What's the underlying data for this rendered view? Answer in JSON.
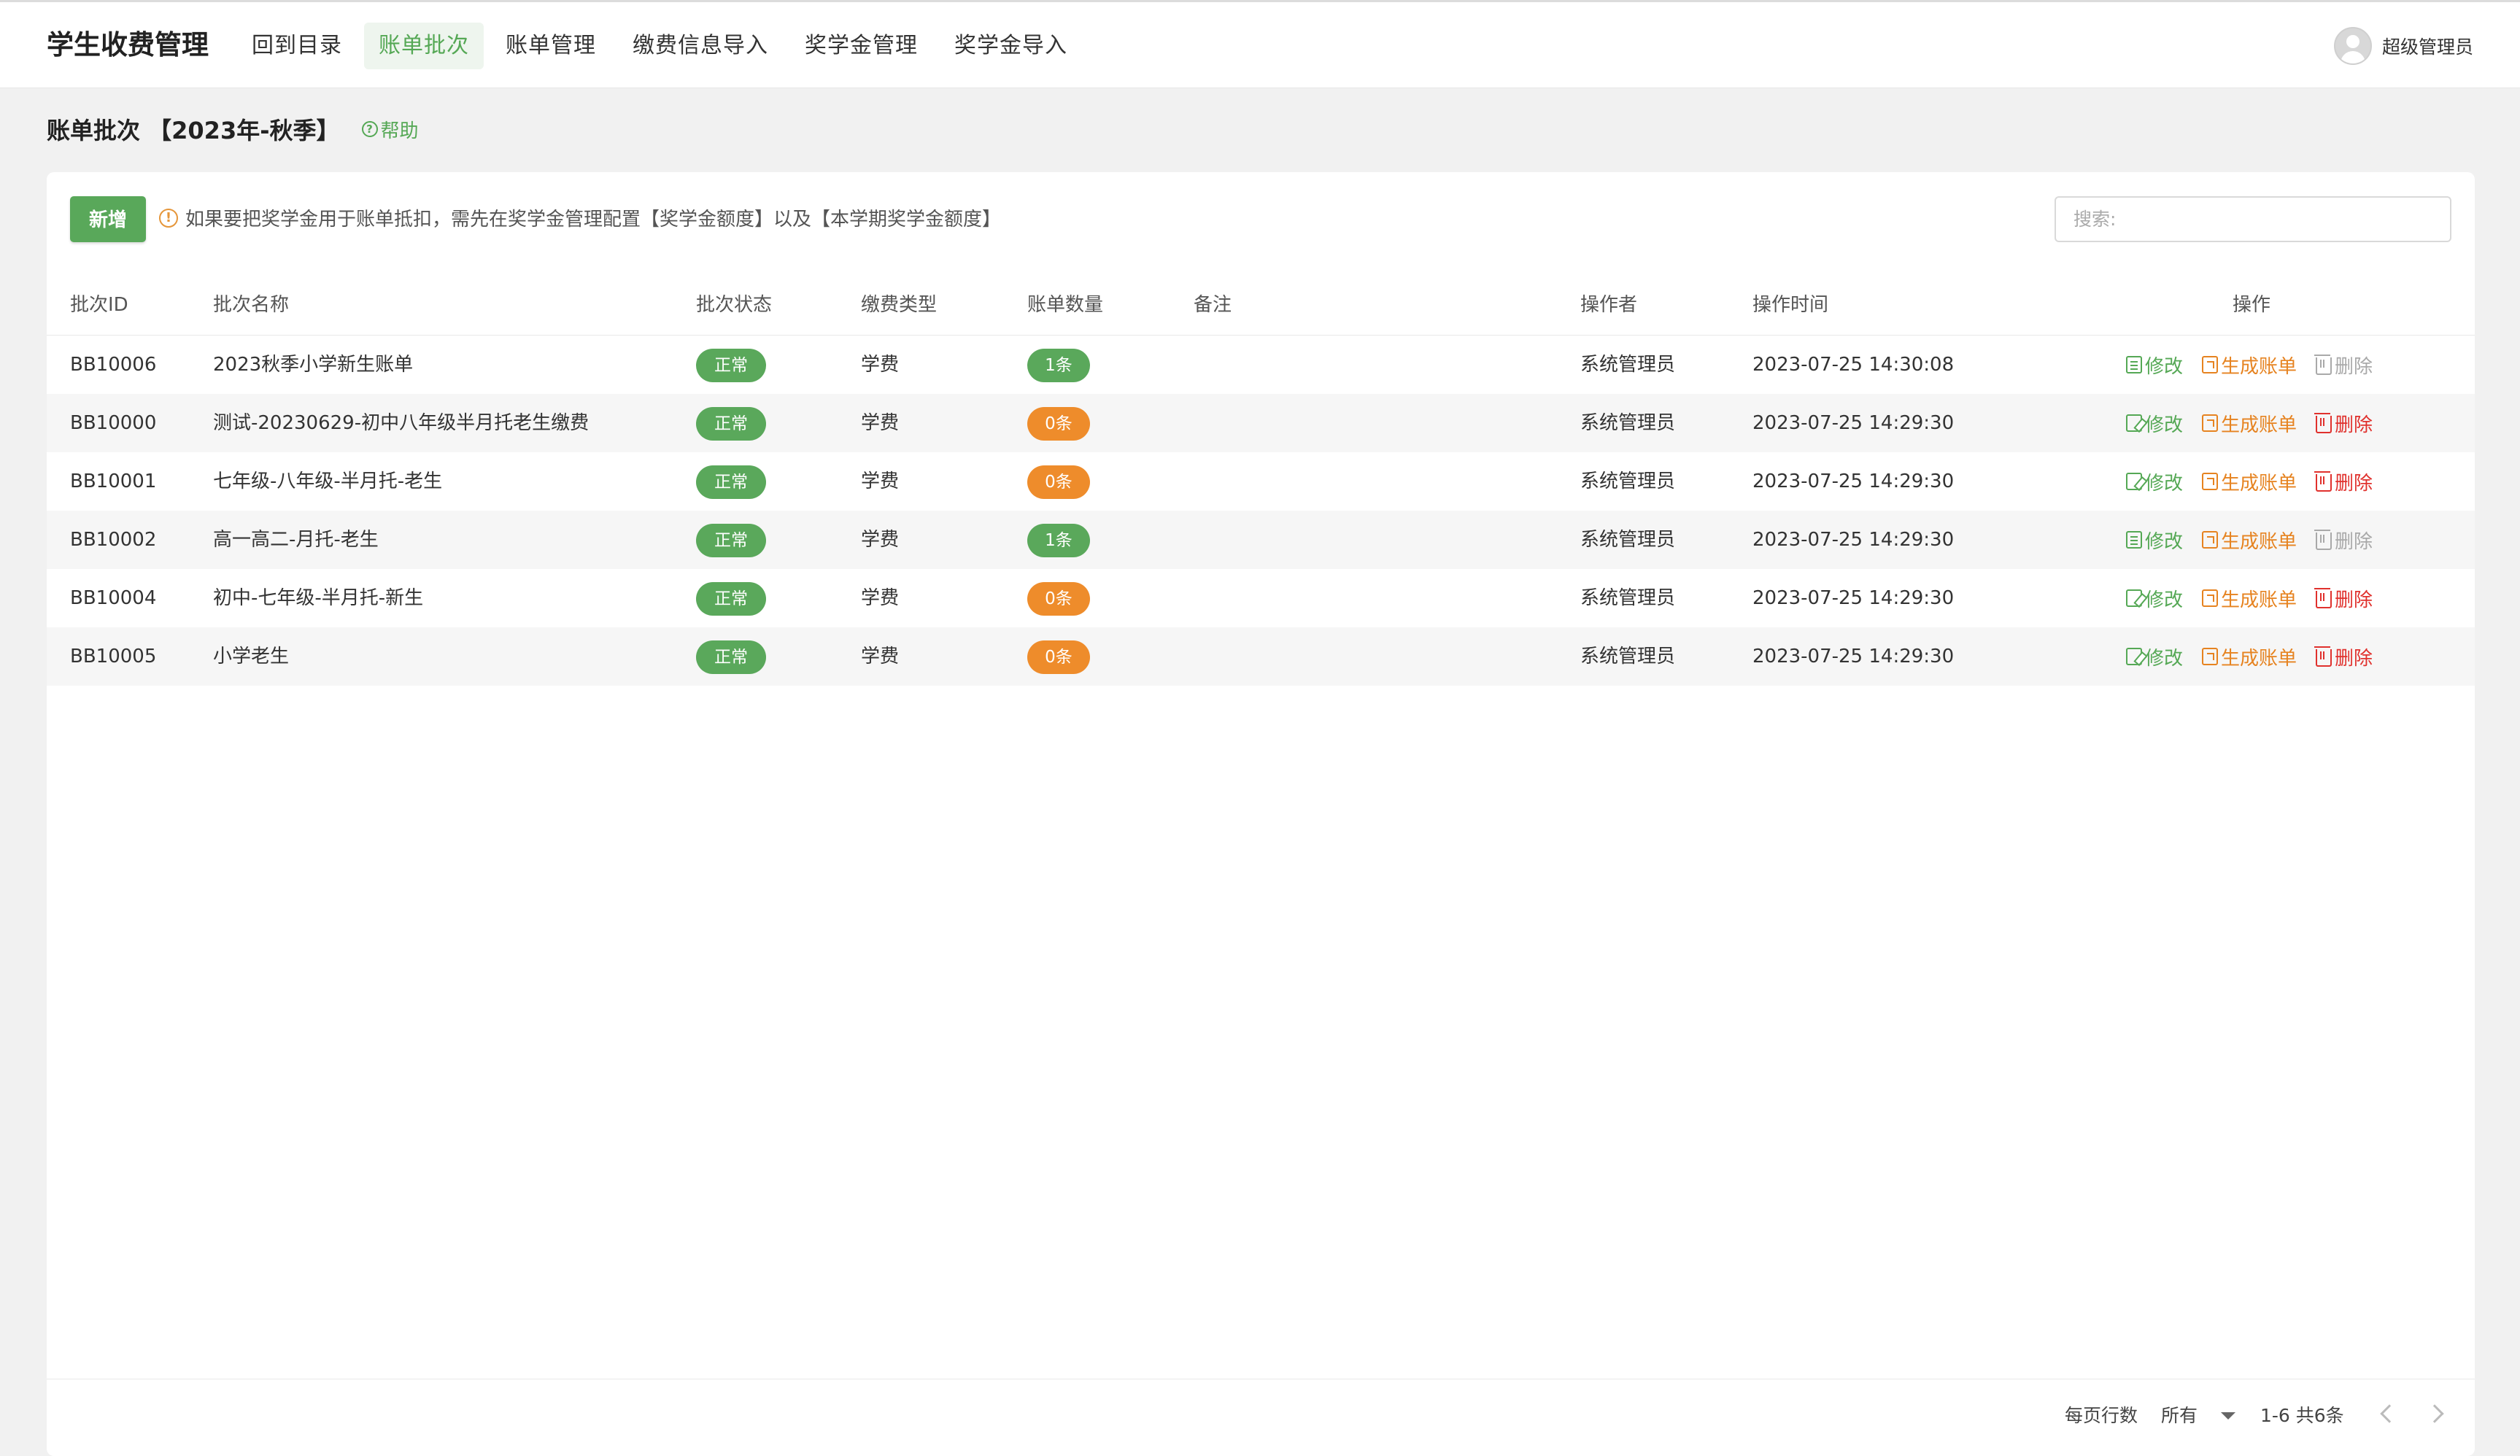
{
  "app": {
    "title": "学生收费管理"
  },
  "nav": [
    {
      "label": "回到目录",
      "active": false
    },
    {
      "label": "账单批次",
      "active": true
    },
    {
      "label": "账单管理",
      "active": false
    },
    {
      "label": "缴费信息导入",
      "active": false
    },
    {
      "label": "奖学金管理",
      "active": false
    },
    {
      "label": "奖学金导入",
      "active": false
    }
  ],
  "user": {
    "name": "超级管理员",
    "icon": "avatar-icon"
  },
  "page": {
    "title": "账单批次 【2023年-秋季】",
    "help": "帮助"
  },
  "toolbar": {
    "add_label": "新增",
    "notice": "如果要把奖学金用于账单抵扣，需先在奖学金管理配置【奖学金额度】以及【本学期奖学金额度】",
    "search_placeholder": "搜索:"
  },
  "table": {
    "headers": {
      "id": "批次ID",
      "name": "批次名称",
      "status": "批次状态",
      "type": "缴费类型",
      "count": "账单数量",
      "remark": "备注",
      "operator": "操作者",
      "time": "操作时间",
      "actions": "操作"
    },
    "action_labels": {
      "edit": "修改",
      "generate": "生成账单",
      "delete": "删除"
    },
    "rows": [
      {
        "id": "BB10006",
        "name": "2023秋季小学新生账单",
        "status": "正常",
        "type": "学费",
        "count": "1条",
        "count_color": "green",
        "remark": "",
        "operator": "系统管理员",
        "time": "2023-07-25 14:30:08",
        "delete_enabled": false
      },
      {
        "id": "BB10000",
        "name": "测试-20230629-初中八年级半月托老生缴费",
        "status": "正常",
        "type": "学费",
        "count": "0条",
        "count_color": "orange",
        "remark": "",
        "operator": "系统管理员",
        "time": "2023-07-25 14:29:30",
        "delete_enabled": true
      },
      {
        "id": "BB10001",
        "name": "七年级-八年级-半月托-老生",
        "status": "正常",
        "type": "学费",
        "count": "0条",
        "count_color": "orange",
        "remark": "",
        "operator": "系统管理员",
        "time": "2023-07-25 14:29:30",
        "delete_enabled": true
      },
      {
        "id": "BB10002",
        "name": "高一高二-月托-老生",
        "status": "正常",
        "type": "学费",
        "count": "1条",
        "count_color": "green",
        "remark": "",
        "operator": "系统管理员",
        "time": "2023-07-25 14:29:30",
        "delete_enabled": false
      },
      {
        "id": "BB10004",
        "name": "初中-七年级-半月托-新生",
        "status": "正常",
        "type": "学费",
        "count": "0条",
        "count_color": "orange",
        "remark": "",
        "operator": "系统管理员",
        "time": "2023-07-25 14:29:30",
        "delete_enabled": true
      },
      {
        "id": "BB10005",
        "name": "小学老生",
        "status": "正常",
        "type": "学费",
        "count": "0条",
        "count_color": "orange",
        "remark": "",
        "operator": "系统管理员",
        "time": "2023-07-25 14:29:30",
        "delete_enabled": true
      }
    ]
  },
  "pagination": {
    "rows_per_page_label": "每页行数",
    "rows_per_page_value": "所有",
    "range": "1-6  共6条"
  },
  "colors": {
    "accent": "#59a85a",
    "warning": "#ee8c2b",
    "danger": "#e0312d"
  }
}
